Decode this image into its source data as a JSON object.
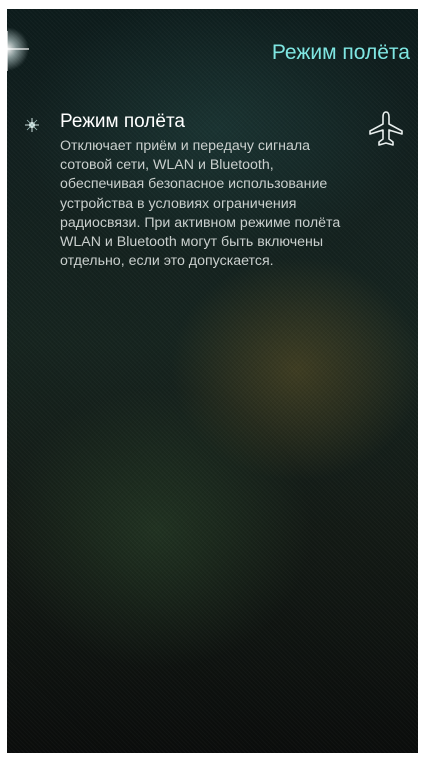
{
  "header": {
    "title": "Режим полёта"
  },
  "setting": {
    "title": "Режим полёта",
    "description": "Отключает приём и передачу сигнала сотовой сети, WLAN и Bluetooth, обеспечивая безопасное использование устройства в условиях ограничения радиосвязи. При активном режиме полёта WLAN и Bluetooth могут быть включены отдельно, если это допускается.",
    "icon": "airplane-icon"
  },
  "colors": {
    "title_accent": "#7fe6e2",
    "text_primary": "#ffffff",
    "text_secondary": "#c9cfcd"
  }
}
